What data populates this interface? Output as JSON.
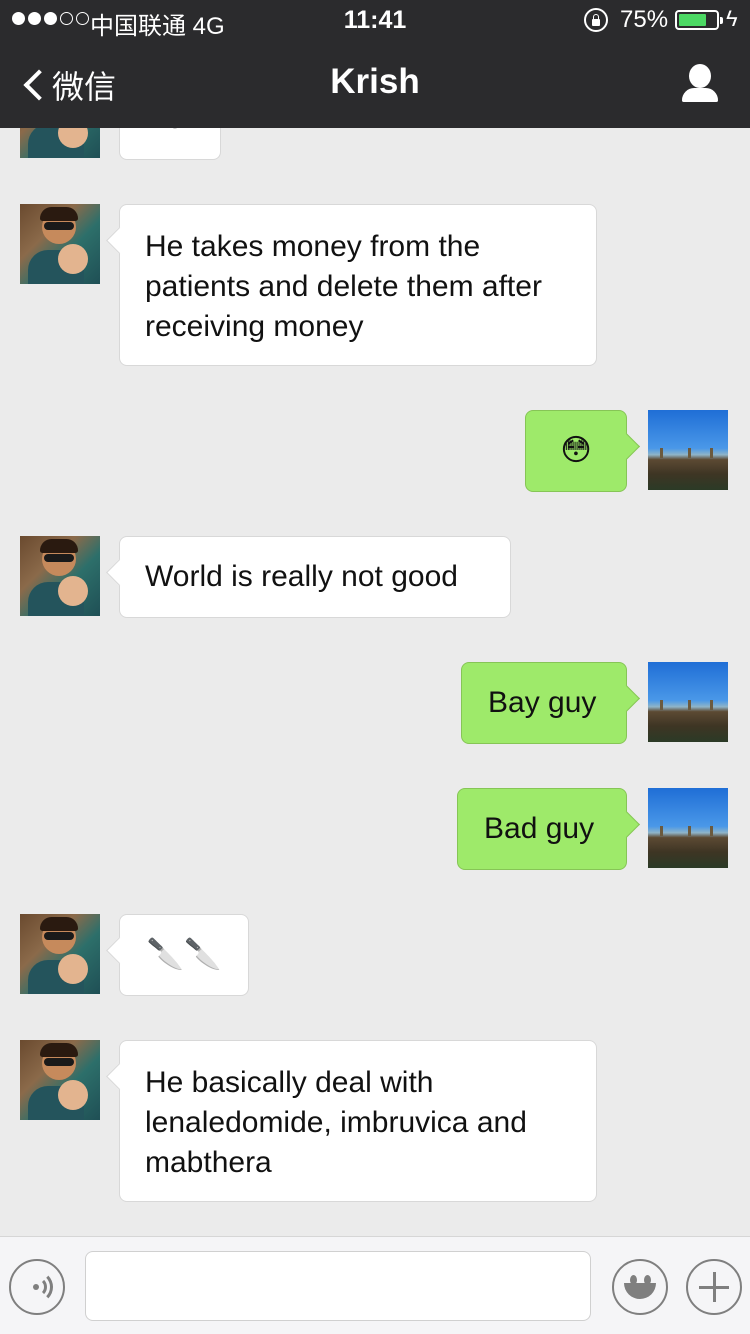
{
  "status_bar": {
    "carrier": "中国联通  4G",
    "time": "11:41",
    "battery_text": "75%",
    "battery_level": 0.75,
    "battery_color": "#4cd964"
  },
  "nav": {
    "back_label": "微信",
    "title": "Krish"
  },
  "messages": [
    {
      "side": "in",
      "text": "No"
    },
    {
      "side": "in",
      "text": "He takes money from the patients and delete them after receiving money"
    },
    {
      "side": "out",
      "text": "😳"
    },
    {
      "side": "in",
      "text": "World is really not good"
    },
    {
      "side": "out",
      "text": "Bay guy"
    },
    {
      "side": "out",
      "text": "Bad guy"
    },
    {
      "side": "in",
      "text": "🔪🔪"
    },
    {
      "side": "in",
      "text": "He basically deal with lenaledomide, imbruvica and mabthera"
    }
  ],
  "input": {
    "placeholder": "",
    "value": ""
  },
  "colors": {
    "nav_background": "#2b2b2d",
    "chat_background": "#ebebeb",
    "incoming_bubble": "#ffffff",
    "outgoing_bubble": "#9eea6a"
  }
}
